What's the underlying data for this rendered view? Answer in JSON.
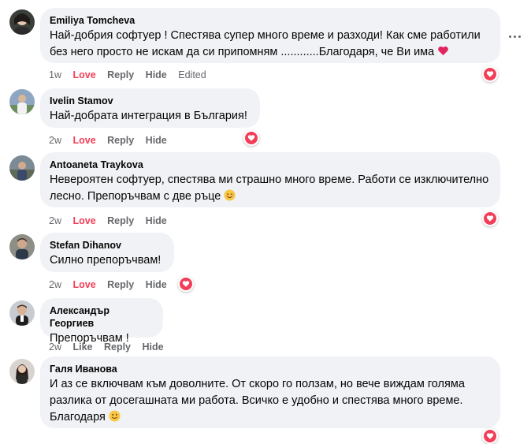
{
  "comments": [
    {
      "author": "Emiliya Tomcheva",
      "text": "Най-добрия софтуер ! Спестява супер много време и разходи! Как сме работили без него просто не искам да си припомням ............Благодаря, че Ви има",
      "trailing_emoji": "heart-emoji",
      "time": "1w",
      "actions": [
        "Love",
        "Reply",
        "Hide"
      ],
      "edited": "Edited",
      "reaction": "love",
      "avatar_bg": "#3a3f3a"
    },
    {
      "author": "Ivelin Stamov",
      "text": "Най-добрата интеграция в България!",
      "time": "2w",
      "actions": [
        "Love",
        "Reply",
        "Hide"
      ],
      "reaction": "love",
      "avatar_bg": "#8ea6c2"
    },
    {
      "author": "Antoaneta Traykova",
      "text": "Невероятен софтуер, спестява ми страшно много време. Работи се изключително лесно. Препоръчвам с две ръце",
      "trailing_emoji": "smiling-face-emoji",
      "time": "2w",
      "actions": [
        "Love",
        "Reply",
        "Hide"
      ],
      "reaction": "love",
      "avatar_bg": "#7b8a95"
    },
    {
      "author": "Stefan Dihanov",
      "text": "Силно препоръчвам!",
      "time": "2w",
      "actions": [
        "Love",
        "Reply",
        "Hide"
      ],
      "reaction": "love",
      "avatar_bg": "#8d8e86"
    },
    {
      "author": "Александър Георгиев",
      "text": "Препоръчвам !",
      "time": "2w",
      "actions": [
        "Like",
        "Reply",
        "Hide"
      ],
      "reaction": null,
      "avatar_bg": "#c8ccd2"
    },
    {
      "author": "Галя Иванова",
      "text": "И аз се включвам към доволните. От скоро го ползам, но вече виждам голяма разлика от досегашната ми работа. Всичко е удобно и спестява много време. Благодаря",
      "trailing_emoji": "slightly-smiling-face-emoji",
      "time": "",
      "actions": [],
      "reaction": "love",
      "avatar_bg": "#d9d3cf"
    }
  ],
  "colors": {
    "love": "#f33e58",
    "bubble": "#f0f2f5",
    "meta": "#65676b"
  }
}
